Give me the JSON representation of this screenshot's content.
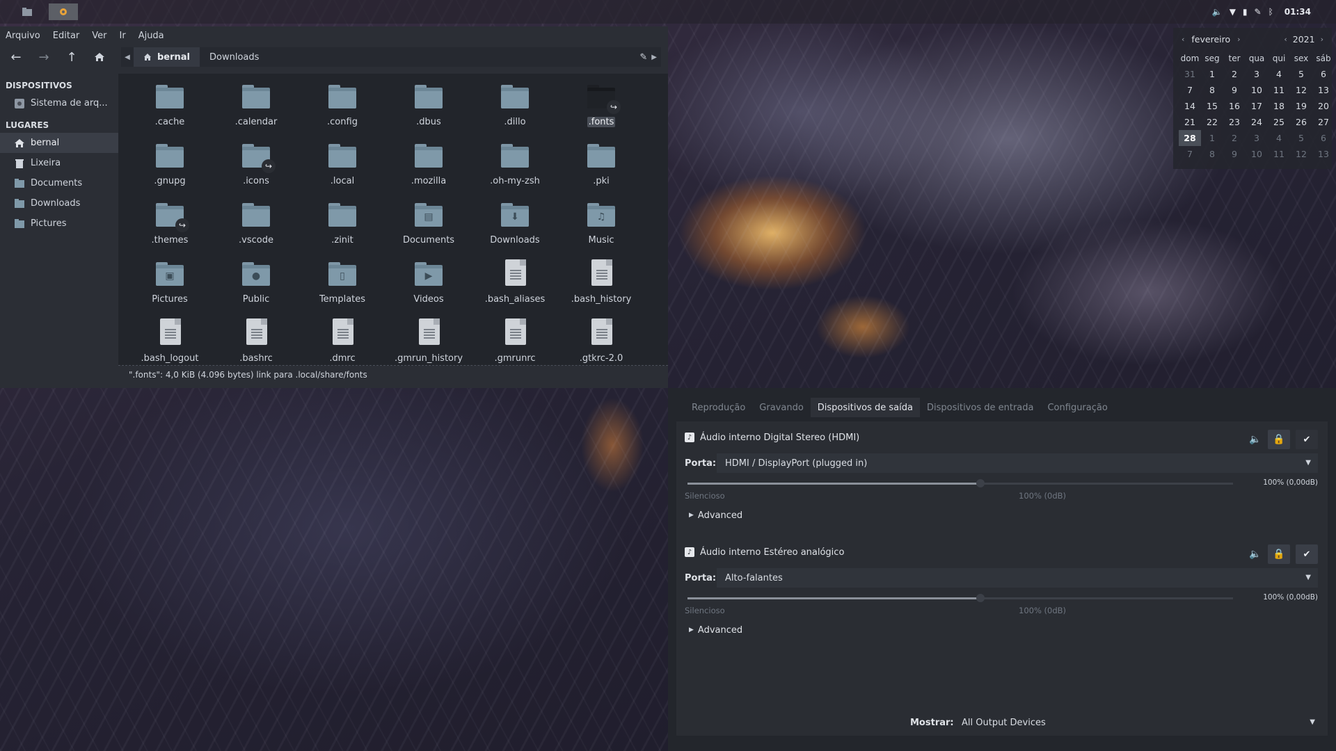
{
  "panel": {
    "clock": "01:34",
    "tray_icons": [
      "volume-icon",
      "wifi-icon",
      "battery-icon",
      "edit-icon",
      "bluetooth-icon"
    ]
  },
  "file_manager": {
    "menu": [
      "Arquivo",
      "Editar",
      "Ver",
      "Ir",
      "Ajuda"
    ],
    "path": [
      "bernal",
      "Downloads"
    ],
    "sidebar": {
      "devices_heading": "DISPOSITIVOS",
      "devices": [
        "Sistema de arq..."
      ],
      "places_heading": "LUGARES",
      "places": [
        "bernal",
        "Lixeira",
        "Documents",
        "Downloads",
        "Pictures"
      ]
    },
    "items": [
      {
        "name": ".cache",
        "kind": "folder"
      },
      {
        "name": ".calendar",
        "kind": "folder"
      },
      {
        "name": ".config",
        "kind": "folder"
      },
      {
        "name": ".dbus",
        "kind": "folder"
      },
      {
        "name": ".dillo",
        "kind": "folder"
      },
      {
        "name": ".fonts",
        "kind": "folder-link-selected"
      },
      {
        "name": ".gnupg",
        "kind": "folder"
      },
      {
        "name": ".icons",
        "kind": "folder-link"
      },
      {
        "name": ".local",
        "kind": "folder"
      },
      {
        "name": ".mozilla",
        "kind": "folder"
      },
      {
        "name": ".oh-my-zsh",
        "kind": "folder"
      },
      {
        "name": ".pki",
        "kind": "folder"
      },
      {
        "name": ".themes",
        "kind": "folder-link"
      },
      {
        "name": ".vscode",
        "kind": "folder"
      },
      {
        "name": ".zinit",
        "kind": "folder"
      },
      {
        "name": "Documents",
        "kind": "folder-documents"
      },
      {
        "name": "Downloads",
        "kind": "folder-downloads"
      },
      {
        "name": "Music",
        "kind": "folder-music"
      },
      {
        "name": "Pictures",
        "kind": "folder-pictures"
      },
      {
        "name": "Public",
        "kind": "folder-public"
      },
      {
        "name": "Templates",
        "kind": "folder-templates"
      },
      {
        "name": "Videos",
        "kind": "folder-videos"
      },
      {
        "name": ".bash_aliases",
        "kind": "file"
      },
      {
        "name": ".bash_history",
        "kind": "file"
      },
      {
        "name": ".bash_logout",
        "kind": "file"
      },
      {
        "name": ".bashrc",
        "kind": "file"
      },
      {
        "name": ".dmrc",
        "kind": "file"
      },
      {
        "name": ".gmrun_history",
        "kind": "file"
      },
      {
        "name": ".gmrunrc",
        "kind": "file"
      },
      {
        "name": ".gtkrc-2.0",
        "kind": "file"
      }
    ],
    "status": "\".fonts\": 4,0 KiB (4.096 bytes) link para .local/share/fonts"
  },
  "calendar": {
    "month": "fevereiro",
    "year": "2021",
    "weekdays": [
      "dom",
      "seg",
      "ter",
      "qua",
      "qui",
      "sex",
      "sáb"
    ],
    "weeks": [
      [
        "31",
        "1",
        "2",
        "3",
        "4",
        "5",
        "6"
      ],
      [
        "7",
        "8",
        "9",
        "10",
        "11",
        "12",
        "13"
      ],
      [
        "14",
        "15",
        "16",
        "17",
        "18",
        "19",
        "20"
      ],
      [
        "21",
        "22",
        "23",
        "24",
        "25",
        "26",
        "27"
      ],
      [
        "28",
        "1",
        "2",
        "3",
        "4",
        "5",
        "6"
      ],
      [
        "7",
        "8",
        "9",
        "10",
        "11",
        "12",
        "13"
      ]
    ],
    "today": "28"
  },
  "volume": {
    "tabs": [
      "Reprodução",
      "Gravando",
      "Dispositivos de saída",
      "Dispositivos de entrada",
      "Configuração"
    ],
    "active_tab": "Dispositivos de saída",
    "devices": [
      {
        "name": "Áudio interno Digital Stereo (HDMI)",
        "port_label": "Porta:",
        "port": "HDMI / DisplayPort (plugged in)",
        "level_percent": 100,
        "level_text": "100% (0,00dB)",
        "silent_label": "Silencioso",
        "mark_label": "100% (0dB)",
        "advanced": "Advanced",
        "default": false
      },
      {
        "name": "Áudio interno Estéreo analógico",
        "port_label": "Porta:",
        "port": "Alto-falantes",
        "level_percent": 100,
        "level_text": "100% (0,00dB)",
        "silent_label": "Silencioso",
        "mark_label": "100% (0dB)",
        "advanced": "Advanced",
        "default": true
      }
    ],
    "show_label": "Mostrar:",
    "show_value": "All Output Devices"
  }
}
